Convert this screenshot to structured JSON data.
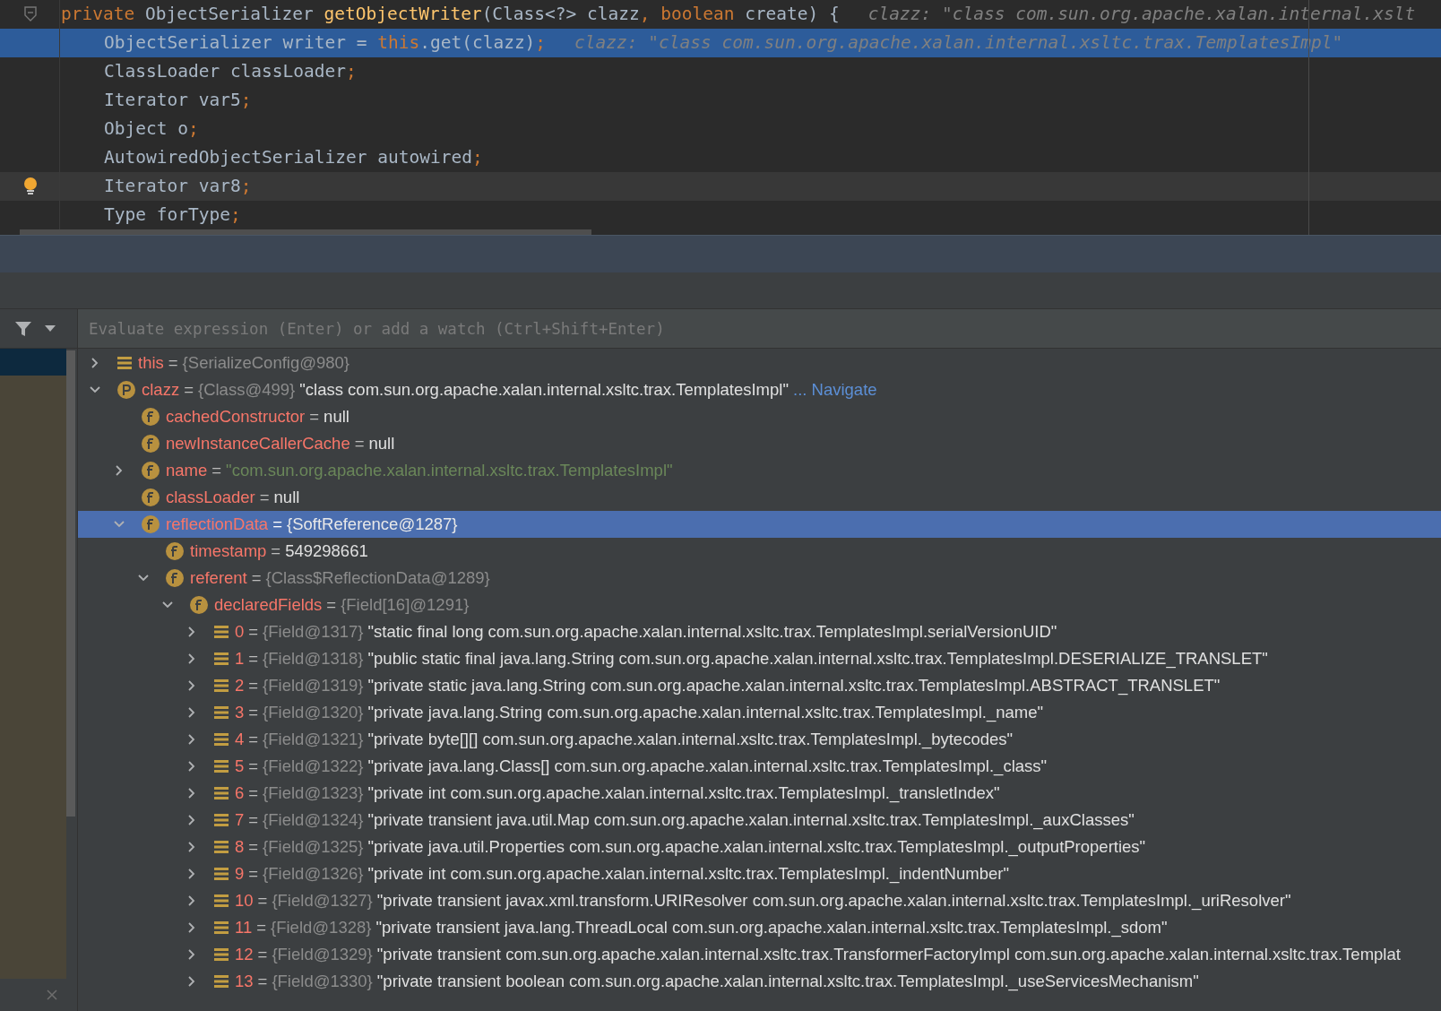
{
  "editor": {
    "lines": [
      {
        "current": false,
        "fold": true,
        "tokens": [
          {
            "kind": "kw",
            "text": "private "
          },
          {
            "kind": "plain",
            "text": "ObjectSerializer "
          },
          {
            "kind": "method",
            "text": "getObjectWriter"
          },
          {
            "kind": "plain",
            "text": "(Class<?> clazz"
          },
          {
            "kind": "kw",
            "text": ", boolean "
          },
          {
            "kind": "plain",
            "text": "create) {"
          },
          {
            "kind": "hint",
            "text": "clazz: \"class com.sun.org.apache.xalan.internal.xslt"
          }
        ],
        "children": [
          {
            "current": true,
            "tokens": [
              {
                "kind": "plain",
                "text": "ObjectSerializer writer = "
              },
              {
                "kind": "kw",
                "text": "this"
              },
              {
                "kind": "plain",
                "text": ".get(clazz)"
              },
              {
                "kind": "kw",
                "text": ";"
              },
              {
                "kind": "hint",
                "text": "clazz: \"class com.sun.org.apache.xalan.internal.xsltc.trax.TemplatesImpl\""
              }
            ]
          },
          {
            "current": false,
            "tokens": [
              {
                "kind": "plain",
                "text": "ClassLoader classLoader"
              },
              {
                "kind": "kw",
                "text": ";"
              }
            ]
          },
          {
            "current": false,
            "tokens": [
              {
                "kind": "plain",
                "text": "Iterator var5"
              },
              {
                "kind": "kw",
                "text": ";"
              }
            ]
          },
          {
            "current": false,
            "tokens": [
              {
                "kind": "plain",
                "text": "Object o"
              },
              {
                "kind": "kw",
                "text": ";"
              }
            ]
          },
          {
            "current": false,
            "tokens": [
              {
                "kind": "plain",
                "text": "AutowiredObjectSerializer autowired"
              },
              {
                "kind": "kw",
                "text": ";"
              }
            ]
          },
          {
            "current": false,
            "hover": true,
            "bulb": true,
            "tokens": [
              {
                "kind": "plain",
                "text": "Iterator var8"
              },
              {
                "kind": "kw",
                "text": ";"
              }
            ]
          },
          {
            "current": false,
            "tokens": [
              {
                "kind": "plain",
                "text": "Type forType"
              },
              {
                "kind": "kw",
                "text": ";"
              }
            ]
          }
        ]
      }
    ]
  },
  "watch_field": {
    "placeholder": "Evaluate expression (Enter) or add a watch (Ctrl+Shift+Enter)"
  },
  "variables": [
    {
      "kind": "list",
      "name": "this",
      "sign": "=",
      "ref": "{SerializeConfig@980}",
      "expanded": false,
      "selected": false
    },
    {
      "kind": "param",
      "name": "clazz",
      "sign": "=",
      "ref": "{Class@499}",
      "value": "\"class com.sun.org.apache.xalan.internal.xsltc.trax.TemplatesImpl\"",
      "link": "... Navigate",
      "expanded": true,
      "selected": false,
      "children": [
        {
          "kind": "field",
          "name": "cachedConstructor",
          "sign": "=",
          "value": "null",
          "selected": false
        },
        {
          "kind": "field",
          "name": "newInstanceCallerCache",
          "sign": "=",
          "value": "null",
          "selected": false
        },
        {
          "kind": "strfield",
          "name": "name",
          "sign": "=",
          "value": "\"com.sun.org.apache.xalan.internal.xsltc.trax.TemplatesImpl\"",
          "expanded": false,
          "selected": false
        },
        {
          "kind": "field",
          "name": "classLoader",
          "sign": "=",
          "value": "null",
          "selected": false
        },
        {
          "kind": "field",
          "name": "reflectionData",
          "sign": "=",
          "ref": "{SoftReference@1287}",
          "expanded": true,
          "selected": true,
          "children": [
            {
              "kind": "field",
              "name": "timestamp",
              "sign": "=",
              "value": "549298661",
              "selected": false
            },
            {
              "kind": "field",
              "name": "referent",
              "sign": "=",
              "ref": "{Class$ReflectionData@1289}",
              "expanded": true,
              "selected": false,
              "children": [
                {
                  "kind": "field",
                  "name": "declaredFields",
                  "sign": "=",
                  "ref": "{Field[16]@1291}",
                  "expanded": true,
                  "selected": false,
                  "children": [
                    {
                      "kind": "list",
                      "name": "0",
                      "sign": "=",
                      "ref": "{Field@1317}",
                      "value": "\"static final long com.sun.org.apache.xalan.internal.xsltc.trax.TemplatesImpl.serialVersionUID\"",
                      "expanded": false,
                      "selected": false
                    },
                    {
                      "kind": "list",
                      "name": "1",
                      "sign": "=",
                      "ref": "{Field@1318}",
                      "value": "\"public static final java.lang.String com.sun.org.apache.xalan.internal.xsltc.trax.TemplatesImpl.DESERIALIZE_TRANSLET\"",
                      "expanded": false,
                      "selected": false
                    },
                    {
                      "kind": "list",
                      "name": "2",
                      "sign": "=",
                      "ref": "{Field@1319}",
                      "value": "\"private static java.lang.String com.sun.org.apache.xalan.internal.xsltc.trax.TemplatesImpl.ABSTRACT_TRANSLET\"",
                      "expanded": false,
                      "selected": false
                    },
                    {
                      "kind": "list",
                      "name": "3",
                      "sign": "=",
                      "ref": "{Field@1320}",
                      "value": "\"private java.lang.String com.sun.org.apache.xalan.internal.xsltc.trax.TemplatesImpl._name\"",
                      "expanded": false,
                      "selected": false
                    },
                    {
                      "kind": "list",
                      "name": "4",
                      "sign": "=",
                      "ref": "{Field@1321}",
                      "value": "\"private byte[][] com.sun.org.apache.xalan.internal.xsltc.trax.TemplatesImpl._bytecodes\"",
                      "expanded": false,
                      "selected": false
                    },
                    {
                      "kind": "list",
                      "name": "5",
                      "sign": "=",
                      "ref": "{Field@1322}",
                      "value": "\"private java.lang.Class[] com.sun.org.apache.xalan.internal.xsltc.trax.TemplatesImpl._class\"",
                      "expanded": false,
                      "selected": false
                    },
                    {
                      "kind": "list",
                      "name": "6",
                      "sign": "=",
                      "ref": "{Field@1323}",
                      "value": "\"private int com.sun.org.apache.xalan.internal.xsltc.trax.TemplatesImpl._transletIndex\"",
                      "expanded": false,
                      "selected": false
                    },
                    {
                      "kind": "list",
                      "name": "7",
                      "sign": "=",
                      "ref": "{Field@1324}",
                      "value": "\"private transient java.util.Map com.sun.org.apache.xalan.internal.xsltc.trax.TemplatesImpl._auxClasses\"",
                      "expanded": false,
                      "selected": false
                    },
                    {
                      "kind": "list",
                      "name": "8",
                      "sign": "=",
                      "ref": "{Field@1325}",
                      "value": "\"private java.util.Properties com.sun.org.apache.xalan.internal.xsltc.trax.TemplatesImpl._outputProperties\"",
                      "expanded": false,
                      "selected": false
                    },
                    {
                      "kind": "list",
                      "name": "9",
                      "sign": "=",
                      "ref": "{Field@1326}",
                      "value": "\"private int com.sun.org.apache.xalan.internal.xsltc.trax.TemplatesImpl._indentNumber\"",
                      "expanded": false,
                      "selected": false
                    },
                    {
                      "kind": "list",
                      "name": "10",
                      "sign": "=",
                      "ref": "{Field@1327}",
                      "value": "\"private transient javax.xml.transform.URIResolver com.sun.org.apache.xalan.internal.xsltc.trax.TemplatesImpl._uriResolver\"",
                      "expanded": false,
                      "selected": false
                    },
                    {
                      "kind": "list",
                      "name": "11",
                      "sign": "=",
                      "ref": "{Field@1328}",
                      "value": "\"private transient java.lang.ThreadLocal com.sun.org.apache.xalan.internal.xsltc.trax.TemplatesImpl._sdom\"",
                      "expanded": false,
                      "selected": false
                    },
                    {
                      "kind": "list",
                      "name": "12",
                      "sign": "=",
                      "ref": "{Field@1329}",
                      "value": "\"private transient com.sun.org.apache.xalan.internal.xsltc.trax.TransformerFactoryImpl com.sun.org.apache.xalan.internal.xsltc.trax.Templat",
                      "expanded": false,
                      "selected": false
                    },
                    {
                      "kind": "list",
                      "name": "13",
                      "sign": "=",
                      "ref": "{Field@1330}",
                      "value": "\"private transient boolean com.sun.org.apache.xalan.internal.xsltc.trax.TemplatesImpl._useServicesMechanism\"",
                      "expanded": false,
                      "selected": false
                    }
                  ]
                }
              ]
            }
          ]
        }
      ]
    }
  ],
  "frames": {
    "selected_top": true
  }
}
